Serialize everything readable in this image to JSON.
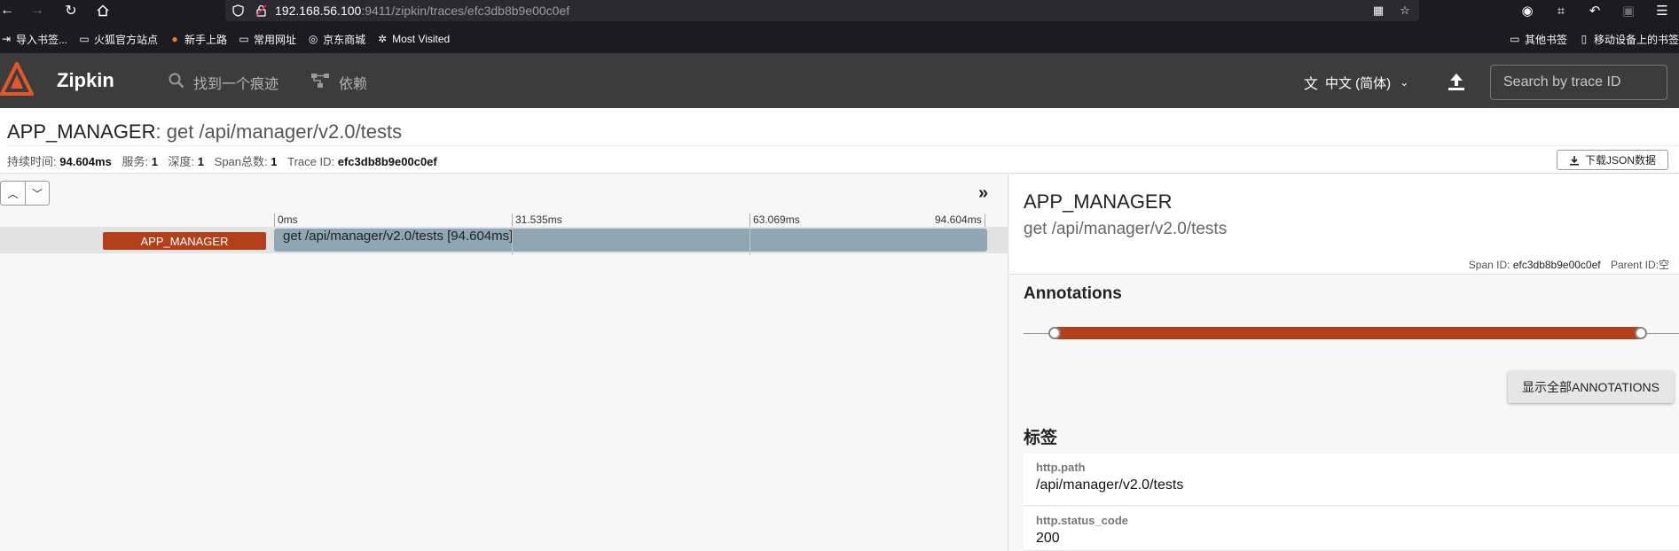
{
  "browser": {
    "url_host": "192.168.56.100",
    "url_rest": ":9411/zipkin/traces/efc3db8b9e00c0ef",
    "bookmarks": [
      {
        "icon": "import-icon",
        "label": "导入书签..."
      },
      {
        "icon": "folder-icon",
        "label": "火狐官方站点"
      },
      {
        "icon": "firefox-icon",
        "label": "新手上路"
      },
      {
        "icon": "folder-icon",
        "label": "常用网址"
      },
      {
        "icon": "globe-icon",
        "label": "京东商城"
      },
      {
        "icon": "gear-icon",
        "label": "Most Visited"
      }
    ],
    "bookmarks_right": [
      {
        "icon": "folder-icon",
        "label": "其他书签"
      },
      {
        "icon": "mobile-icon",
        "label": "移动设备上的书签"
      }
    ]
  },
  "app": {
    "brand": "Zipkin",
    "nav": [
      {
        "icon": "search-icon",
        "label": "找到一个痕迹"
      },
      {
        "icon": "dependencies-icon",
        "label": "依赖"
      }
    ],
    "language": "中文 (简体)",
    "search_placeholder": "Search by trace ID"
  },
  "trace": {
    "service": "APP_MANAGER",
    "separator": ": ",
    "span_name": "get /api/manager/v2.0/tests",
    "stats": {
      "duration_label": "持续时间:",
      "duration": "94.604ms",
      "services_label": "服务:",
      "services": "1",
      "depth_label": "深度:",
      "depth": "1",
      "span_count_label": "Span总数:",
      "span_count": "1",
      "trace_id_label": "Trace ID:",
      "trace_id": "efc3db8b9e00c0ef"
    },
    "download_label": "下载JSON数据"
  },
  "timeline": {
    "ticks": [
      "0ms",
      "31.535ms",
      "63.069ms",
      "94.604ms"
    ],
    "span_service": "APP_MANAGER",
    "span_label": "get /api/manager/v2.0/tests [94.604ms]"
  },
  "detail": {
    "service": "APP_MANAGER",
    "span_name": "get /api/manager/v2.0/tests",
    "span_id_label": "Span ID:",
    "span_id": "efc3db8b9e00c0ef",
    "parent_id_label": "Parent ID:",
    "parent_id": "空",
    "annotations_title": "Annotations",
    "show_annotations_label": "显示全部ANNOTATIONS",
    "tags_title": "标签",
    "tags": [
      {
        "key": "http.path",
        "value": "/api/manager/v2.0/tests"
      },
      {
        "key": "http.status_code",
        "value": "200"
      }
    ]
  },
  "colors": {
    "header_bg": "#3c3c3c",
    "accent": "#b43f1b",
    "span_bar": "#8ea7b3",
    "browser_bg": "#1c1b22"
  }
}
